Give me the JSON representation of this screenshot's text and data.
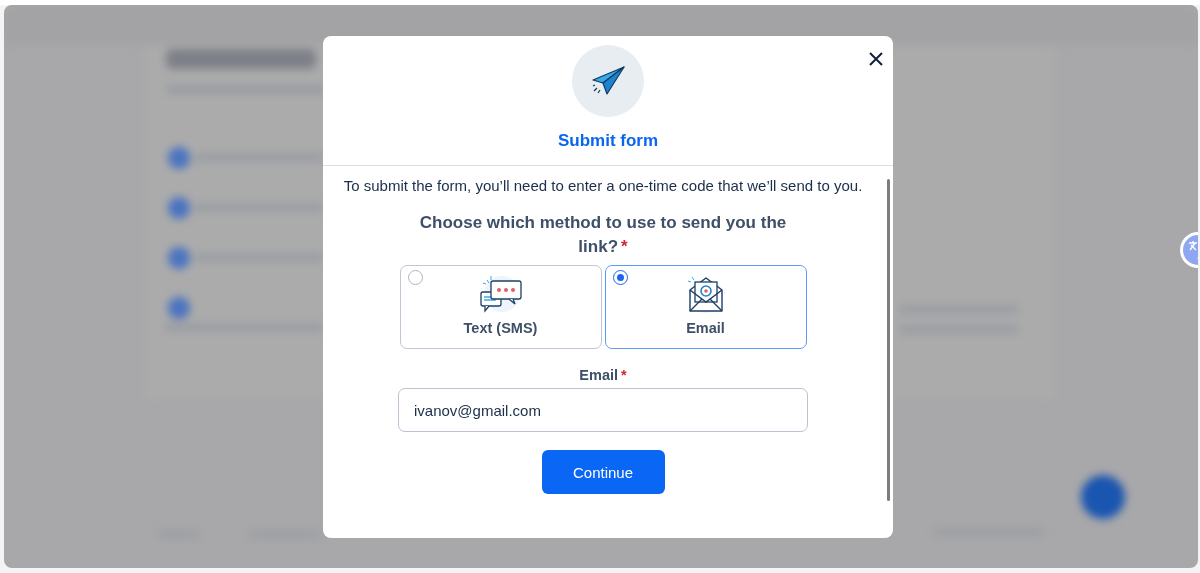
{
  "dialog": {
    "title": "Submit form",
    "description": "To submit the form, you’ll need to enter a one-time code that we’ll send to you.",
    "question": {
      "label": "Choose which method to use to send you the link?",
      "required_mark": "*"
    },
    "options": [
      {
        "label": "Text (SMS)",
        "kind": "sms",
        "selected": false
      },
      {
        "label": "Email",
        "kind": "email",
        "selected": true
      }
    ],
    "field": {
      "label": "Email",
      "required_mark": "*",
      "value": "ivanov@gmail.com"
    },
    "button": "Continue"
  }
}
